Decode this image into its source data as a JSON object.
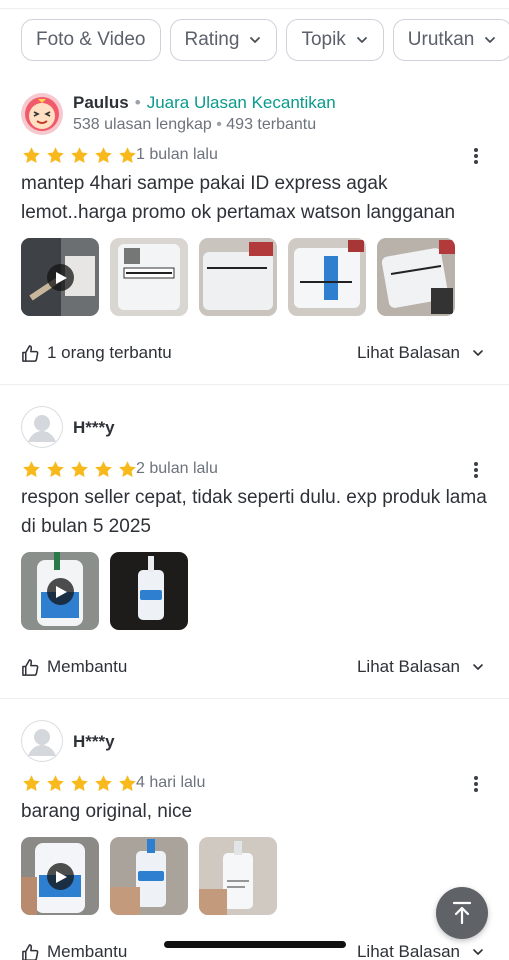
{
  "filters": [
    {
      "label": "Foto & Video",
      "has_chevron": false
    },
    {
      "label": "Rating",
      "has_chevron": true
    },
    {
      "label": "Topik",
      "has_chevron": true
    },
    {
      "label": "Urutkan",
      "has_chevron": true
    }
  ],
  "reviews": [
    {
      "name": "Paulus",
      "badge": "Juara Ulasan Kecantikan",
      "stats_reviews": "538 ulasan lengkap",
      "stats_helpful": "493 terbantu",
      "rating": 5,
      "date": "1 bulan lalu",
      "text": "mantep 4hari sampe pakai ID express agak lemot..harga promo ok pertamax watson langganan",
      "media_count": 5,
      "helpful_label": "1 orang terbantu",
      "replies_label": "Lihat Balasan"
    },
    {
      "name": "H***y",
      "rating": 5,
      "date": "2 bulan lalu",
      "text": "respon seller cepat, tidak seperti dulu. exp produk lama di bulan 5 2025",
      "media_count": 2,
      "helpful_label": "Membantu",
      "replies_label": "Lihat Balasan"
    },
    {
      "name": "H***y",
      "rating": 5,
      "date": "4 hari lalu",
      "text": "barang original, nice",
      "media_count": 3,
      "helpful_label": "Membantu",
      "replies_label": "Lihat Balasan"
    }
  ],
  "icons": {
    "star": "star-icon",
    "thumbs_up": "thumbs-up-icon",
    "chevron": "chevron-down-icon",
    "more": "more-vertical-icon",
    "play": "play-icon",
    "scroll_top": "arrow-up-icon"
  },
  "colors": {
    "star": "#f8b91d",
    "badge": "#0a9a8c",
    "chip_border": "#cfd3d9",
    "scroll_top_bg": "#5f6368"
  }
}
